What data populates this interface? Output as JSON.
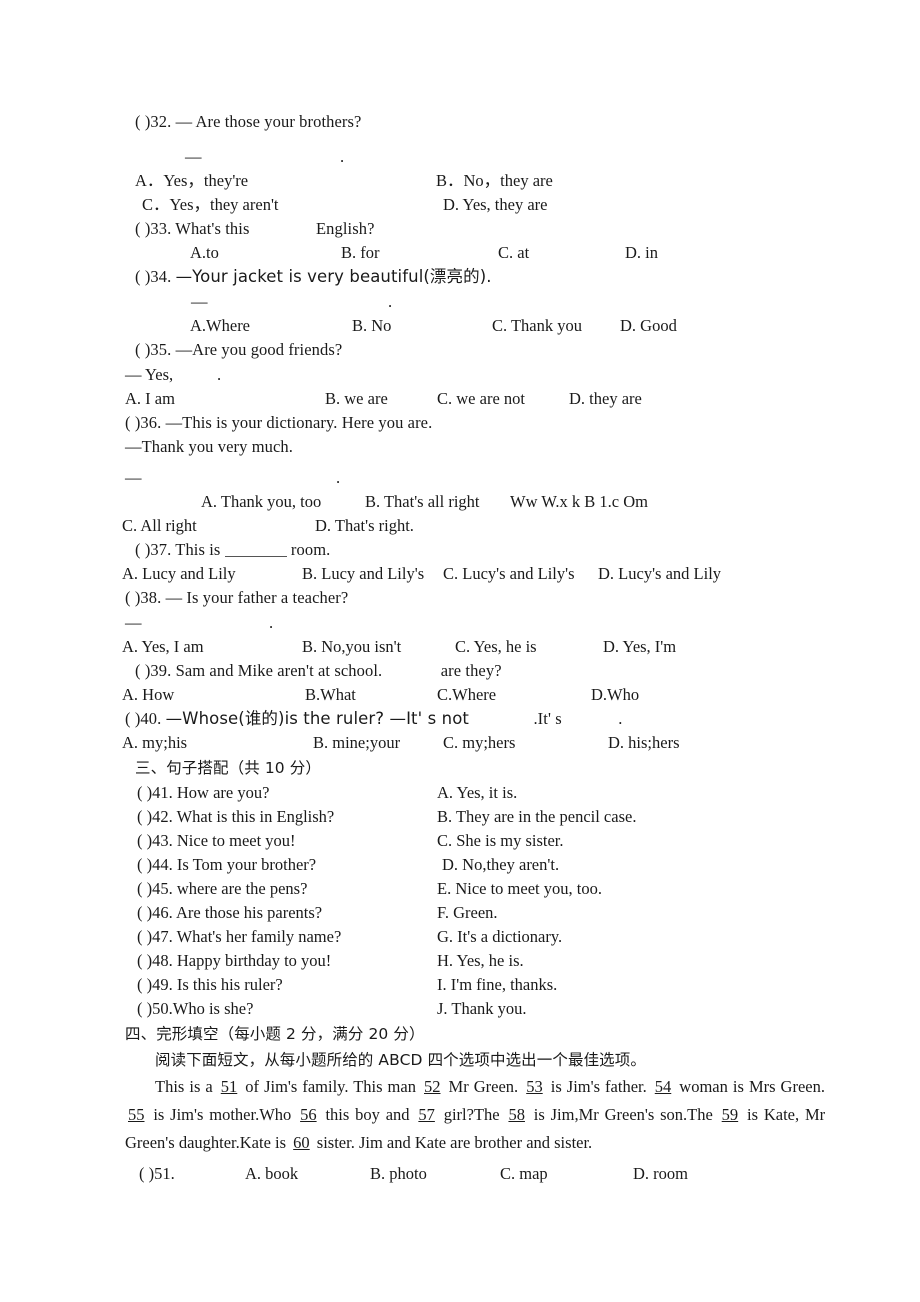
{
  "document": {
    "type": "exam-paper",
    "language": "en-zh"
  },
  "multiple_choice": {
    "q32": {
      "number": "(       )32.",
      "prompt": "— Are those your brothers?",
      "answer_dash": "—",
      "answer_dot": ".",
      "options": [
        "A．Yes，they're",
        "B．No，they are",
        "C．Yes，they aren't",
        "D. Yes, they are"
      ]
    },
    "q33": {
      "number": "(       )33.",
      "prompt": "What's this",
      "prompt_tail": "English?",
      "options": [
        "A.to",
        "B. for",
        "C. at",
        "D. in"
      ]
    },
    "q34": {
      "number": "(       )34.",
      "prompt": "—Your jacket is very beautiful(漂亮的).",
      "answer_dash": "—",
      "answer_dot": ".",
      "options": [
        "A.Where",
        "B. No",
        "C. Thank you",
        "D. Good"
      ]
    },
    "q35": {
      "number": "(       )35.",
      "prompt": "—Are you good friends?",
      "answer_line": "— Yes,",
      "answer_dot": ".",
      "options": [
        "A. I am",
        "B. we are",
        "C. we are not",
        "D. they are"
      ]
    },
    "q36": {
      "number": "(     )36.",
      "prompt": "—This is your dictionary. Here you are.",
      "reply": "—Thank you very much.",
      "answer_dash": "—",
      "answer_dot": ".",
      "options": [
        "A. Thank you, too",
        "B. That's all right",
        "C. All right",
        "D. That's right."
      ],
      "watermark": "Ww W.x k B 1.c Om"
    },
    "q37": {
      "number": "(      )37.",
      "prompt_head": "This is",
      "prompt_tail": "room.",
      "options": [
        "A. Lucy and Lily",
        "B. Lucy and Lily's",
        "C. Lucy's and Lily's",
        "D. Lucy's and Lily"
      ]
    },
    "q38": {
      "number": "(     )38.",
      "prompt": "— Is your father a teacher?",
      "answer_dash": "—",
      "answer_dot": ".",
      "options": [
        "A. Yes, I am",
        "B. No,you isn't",
        "C. Yes, he is",
        "D. Yes, I'm"
      ]
    },
    "q39": {
      "number": "(      )39.",
      "prompt": "Sam and Mike aren't at school.",
      "prompt_tail": "are they?",
      "options": [
        "A. How",
        "B.What",
        "C.Where",
        "D.Who"
      ]
    },
    "q40": {
      "number": "(      )40.",
      "prompt": "—Whose(谁的)is the ruler? —It' s not",
      "prompt_mid": ".It' s",
      "prompt_dot": ".",
      "options": [
        "A. my;his",
        "B. mine;your",
        "C. my;hers",
        "D. his;hers"
      ]
    }
  },
  "section_three": {
    "heading": "三、句子搭配（共 10 分）",
    "items": [
      {
        "number": "(    )41.",
        "question": "How are you?"
      },
      {
        "number": "(    )42.",
        "question": "What is this in English?"
      },
      {
        "number": "(    )43.",
        "question": "Nice to meet you!"
      },
      {
        "number": "(    )44.",
        "question": "Is Tom your brother?"
      },
      {
        "number": "(    )45.",
        "question": "where are the pens?"
      },
      {
        "number": "(    )46.",
        "question": "Are those his parents?"
      },
      {
        "number": "(    )47.",
        "question": "What's her family name?"
      },
      {
        "number": "(    )48.",
        "question": "Happy birthday to you!"
      },
      {
        "number": "(    )49.",
        "question": "Is this his ruler?"
      },
      {
        "number": "(    )50.",
        "question": "Who is she?"
      }
    ],
    "answers": [
      "A. Yes, it is.",
      "B. They are in the pencil case.",
      "C. She is my sister.",
      "D. No,they aren't.",
      "E. Nice to meet you, too.",
      "F. Green.",
      "G. It's a dictionary.",
      "H. Yes, he is.",
      "I. I'm fine, thanks.",
      "J. Thank you."
    ]
  },
  "section_four": {
    "heading": "四、完形填空（每小题 2 分，满分 20 分）",
    "instruction": "阅读下面短文，从每小题所给的 ABCD 四个选项中选出一个最佳选项。",
    "passage": {
      "t0": "This is a",
      "b51": "51",
      "t1": "of Jim's family. This man",
      "b52": "52",
      "t2": "Mr Green.",
      "b53": "53",
      "t3": "is Jim's father.",
      "b54": "54",
      "t4": "woman is Mrs Green.",
      "b55": "55",
      "t5": "is Jim's mother.Who",
      "b56": "56",
      "t6": "this boy and",
      "b57": "57",
      "t7": "girl?The",
      "b58": "58",
      "t8": "is Jim,Mr Green's son.The",
      "b59": "59",
      "t9": "is Kate, Mr Green's daughter.Kate is",
      "b60": "60",
      "t10": "sister. Jim and Kate are brother and sister."
    },
    "q51": {
      "number": "(  )51.",
      "options": [
        "A. book",
        "B. photo",
        "C. map",
        "D. room"
      ]
    }
  }
}
